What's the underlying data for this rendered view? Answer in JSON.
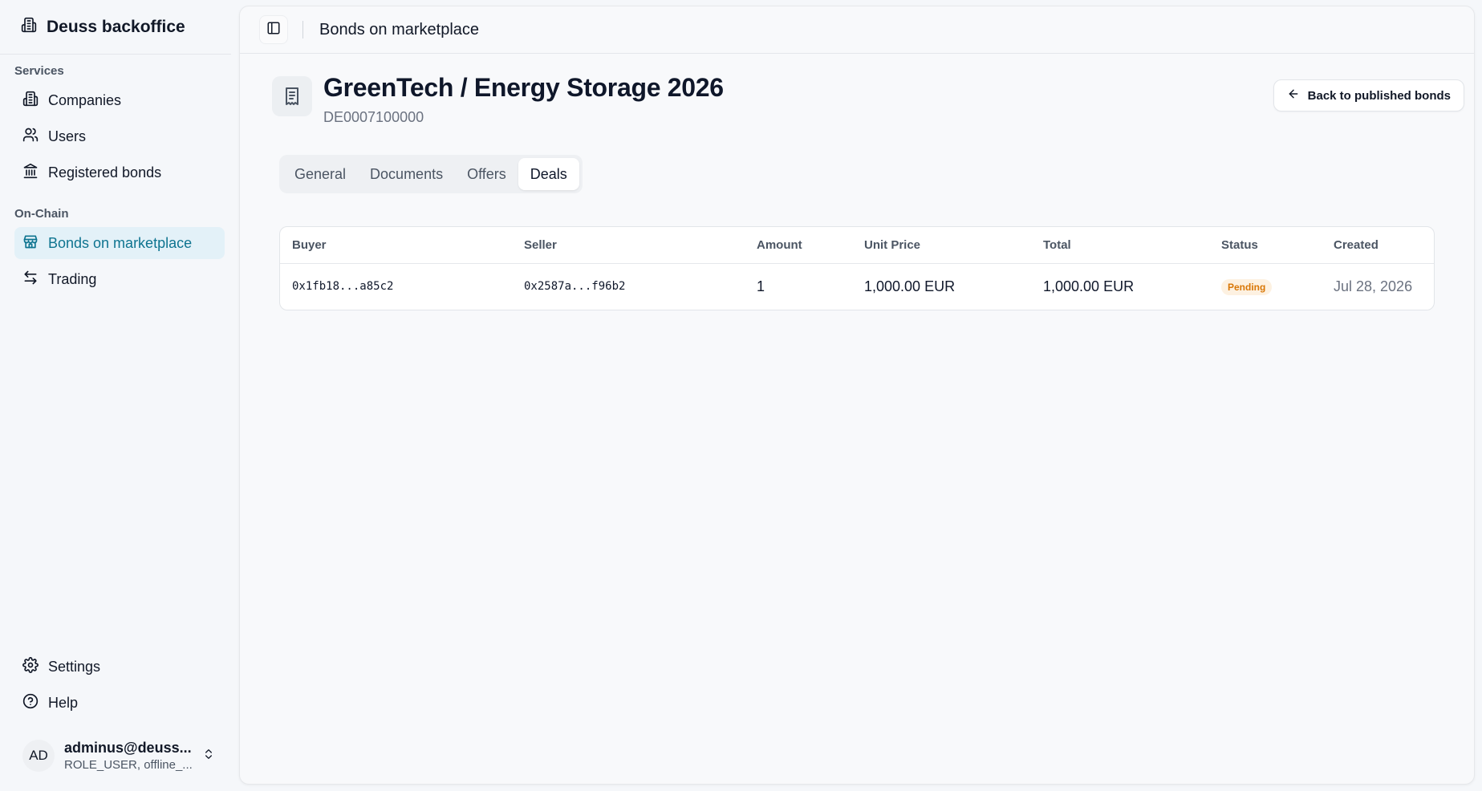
{
  "app": {
    "name": "Deuss backoffice"
  },
  "sidebar": {
    "sections": [
      {
        "label": "Services",
        "items": [
          {
            "label": "Companies",
            "icon": "building-icon"
          },
          {
            "label": "Users",
            "icon": "users-icon"
          },
          {
            "label": "Registered bonds",
            "icon": "bank-icon"
          }
        ]
      },
      {
        "label": "On-Chain",
        "items": [
          {
            "label": "Bonds on marketplace",
            "icon": "store-icon",
            "active": true
          },
          {
            "label": "Trading",
            "icon": "arrows-swap-icon"
          }
        ]
      }
    ],
    "bottom_items": [
      {
        "label": "Settings",
        "icon": "gear-icon"
      },
      {
        "label": "Help",
        "icon": "help-circle-icon"
      }
    ],
    "user": {
      "initials": "AD",
      "email": "adminus@deuss...",
      "role": "ROLE_USER, offline_..."
    }
  },
  "topbar": {
    "title": "Bonds on marketplace"
  },
  "bond": {
    "title": "GreenTech / Energy Storage 2026",
    "isin": "DE0007100000",
    "back_label": "Back to published bonds"
  },
  "tabs": [
    {
      "label": "General"
    },
    {
      "label": "Documents"
    },
    {
      "label": "Offers"
    },
    {
      "label": "Deals",
      "active": true
    }
  ],
  "deals_table": {
    "columns": [
      "Buyer",
      "Seller",
      "Amount",
      "Unit Price",
      "Total",
      "Status",
      "Created"
    ],
    "rows": [
      {
        "buyer": "0x1fb18...a85c2",
        "seller": "0x2587a...f96b2",
        "amount": "1",
        "unit_price": "1,000.00 EUR",
        "total": "1,000.00 EUR",
        "status": "Pending",
        "created": "Jul 28, 2026"
      }
    ]
  },
  "colors": {
    "accent": "#0e7490",
    "active_nav_bg": "#e3f1f8",
    "pending_badge_bg": "#fdf1e1",
    "pending_badge_text": "#d97706"
  }
}
